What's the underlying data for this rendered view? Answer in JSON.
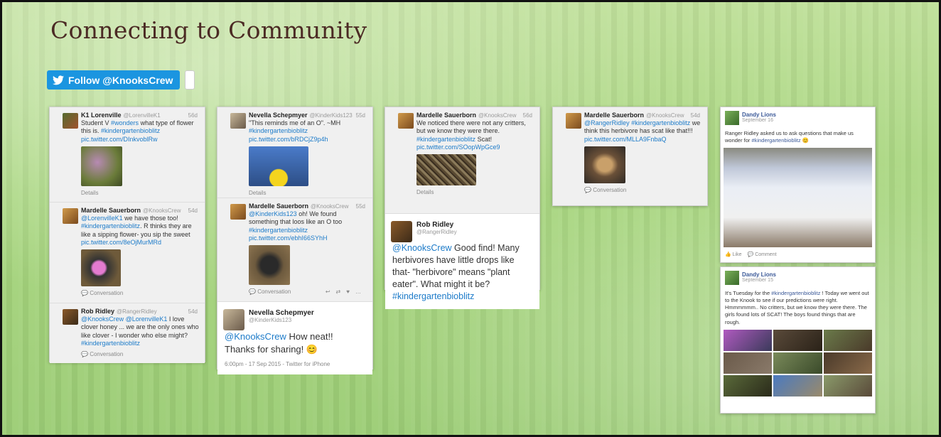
{
  "slide": {
    "title": "Connecting to Community",
    "follow_button_label": "Follow @KnooksCrew"
  },
  "columns": [
    {
      "tweets": [
        {
          "name": "K1 Lorenville",
          "handle": "@LorenvilleK1",
          "age": "56d",
          "text": "Student V ",
          "hashtag1": "#wonders",
          "text2": " what type of flower this is. ",
          "hashtag2": "#kindergartenbioblitz",
          "link": "pic.twitter.com/DInkvoblRw",
          "footer": "Details"
        },
        {
          "name": "Mardelle Sauerborn",
          "handle": "@KnooksCrew",
          "age": "54d",
          "mention": "@LorenvilleK1",
          "text": " we have those too! ",
          "hashtag": "#kindergartenbioblitz",
          "text2": ". R thinks they are like a sipping flower- you sip the sweet ",
          "link": "pic.twitter.com/8eOjMurMRd",
          "footer": "Conversation"
        },
        {
          "name": "Rob Ridley",
          "handle": "@RangerRidley",
          "age": "54d",
          "mention": "@KnooksCrew @LorenvilleK1",
          "text": " I love clover honey ... we are the only ones who like clover - I wonder who else might? ",
          "hashtag": "#kindergartenbioblitz",
          "footer": "Conversation"
        }
      ]
    },
    {
      "tweets": [
        {
          "name": "Nevella Schepmyer",
          "handle": "@KinderKids123",
          "age": "55d",
          "text": "\"This reminds me of an O\". ~MH ",
          "hashtag": "#kindergartenbioblitz",
          "link": "pic.twitter.com/bRDCjZ9p4h",
          "footer": "Details"
        },
        {
          "name": "Mardelle Sauerborn",
          "handle": "@KnooksCrew",
          "age": "55d",
          "mention": "@KinderKids123",
          "text": " oh! We found something that loos like an O too ",
          "hashtag": "#kindergartenbioblitz",
          "link": "pic.twitter.com/ebhI66SYhH",
          "footer": "Conversation"
        }
      ],
      "reply": {
        "name": "Nevella Schepmyer",
        "handle": "@KinderKids123",
        "mention": "@KnooksCrew",
        "text": " How neat!! Thanks for sharing! 😊",
        "time": "6:00pm - 17 Sep 2015 - Twitter for iPhone"
      }
    },
    {
      "tweets": [
        {
          "name": "Mardelle Sauerborn",
          "handle": "@KnooksCrew",
          "age": "56d",
          "text": "We noticed there were not any critters, but we know they were there. ",
          "hashtag": "#kindergartenbioblitz",
          "text2": " Scat! ",
          "link": "pic.twitter.com/SOopWpGce9",
          "footer": "Details"
        }
      ],
      "reply": {
        "name": "Rob Ridley",
        "handle": "@RangerRidley",
        "mention": "@KnooksCrew",
        "text": " Good find! Many herbivores have little drops like that- \"herbivore\" means \"plant eater\". What might it be? ",
        "hashtag": "#kindergartenbioblitz"
      }
    },
    {
      "tweets": [
        {
          "name": "Mardelle Sauerborn",
          "handle": "@KnooksCrew",
          "age": "54d",
          "mention": "@RangerRidley",
          "hashtag": "#kindergartenbioblitz",
          "text": " we think this herbivore has scat like that!!! ",
          "link": "pic.twitter.com/MLLA9FnbaQ",
          "footer": "Conversation"
        }
      ]
    }
  ],
  "facebook": [
    {
      "name": "Dandy Lions",
      "date": "September 16",
      "text": "Ranger Ridley asked us to ask questions that make us wonder for ",
      "hashtag": "#kindergartenbioblitz",
      "like": "Like",
      "comment": "Comment"
    },
    {
      "name": "Dandy Lions",
      "date": "September 15",
      "text1": "It's Tuesday for the ",
      "hashtag": "#kindergartenbioblitz",
      "text2": " ! Today we went out to the Knook to see if our predictions were right. Hmmmmmm.. No critters, but we know they were there. The girls found lots of SCAT! The boys found things that are rough."
    }
  ],
  "colors": {
    "twitter_blue": "#1b95e0",
    "link": "#1d7bc9",
    "title": "#4b2a24",
    "facebook_blue": "#3b5998"
  }
}
